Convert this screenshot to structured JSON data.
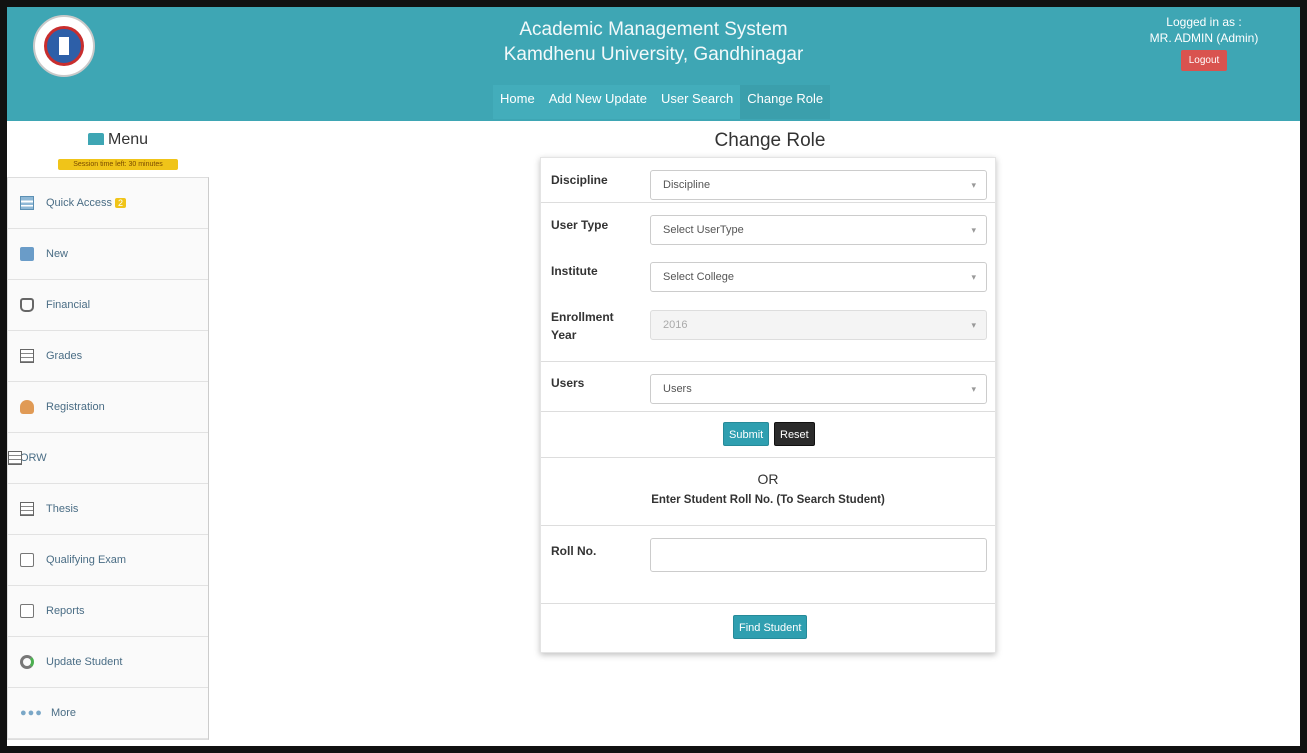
{
  "header": {
    "title_line1": "Academic Management System",
    "title_line2": "Kamdhenu University, Gandhinagar",
    "nav": [
      "Home",
      "Add New Update",
      "User Search",
      "Change Role"
    ],
    "logged_in_label": "Logged in as :",
    "user": "MR. ADMIN (Admin)",
    "logout_label": "Logout"
  },
  "sidebar": {
    "menu_label": "Menu",
    "session_text": "Session time left: 30 minutes",
    "items": [
      {
        "label": "Quick Access",
        "icon": "list-icon",
        "badge": "2"
      },
      {
        "label": "New",
        "icon": "new-document-icon"
      },
      {
        "label": "Financial",
        "icon": "bag-icon"
      },
      {
        "label": "Grades",
        "icon": "grid-icon"
      },
      {
        "label": "Registration",
        "icon": "user-icon"
      },
      {
        "label": "ORW",
        "icon": "grid-icon"
      },
      {
        "label": "Thesis",
        "icon": "grid-icon"
      },
      {
        "label": "Qualifying Exam",
        "icon": "document-icon"
      },
      {
        "label": "Reports",
        "icon": "report-icon"
      },
      {
        "label": "Update Student",
        "icon": "refresh-icon"
      },
      {
        "label": "More",
        "icon": "dots-icon"
      }
    ]
  },
  "main": {
    "page_title": "Change Role",
    "fields": {
      "discipline": {
        "label": "Discipline",
        "value": "Discipline"
      },
      "user_type": {
        "label": "User Type",
        "value": "Select UserType"
      },
      "institute": {
        "label": "Institute",
        "value": "Select College"
      },
      "enrollment_year": {
        "label_line1": "Enrollment",
        "label_line2": "Year",
        "value": "2016"
      },
      "users": {
        "label": "Users",
        "value": "Users"
      }
    },
    "submit_label": "Submit",
    "reset_label": "Reset",
    "or_label": "OR",
    "roll_hint": "Enter Student Roll No. (To Search Student)",
    "roll_label": "Roll No.",
    "roll_value": "",
    "find_label": "Find Student"
  },
  "colors": {
    "header": "#3ea6b4",
    "logout": "#d9534f",
    "primary_button": "#2f9fb0",
    "badge": "#f0c419"
  }
}
